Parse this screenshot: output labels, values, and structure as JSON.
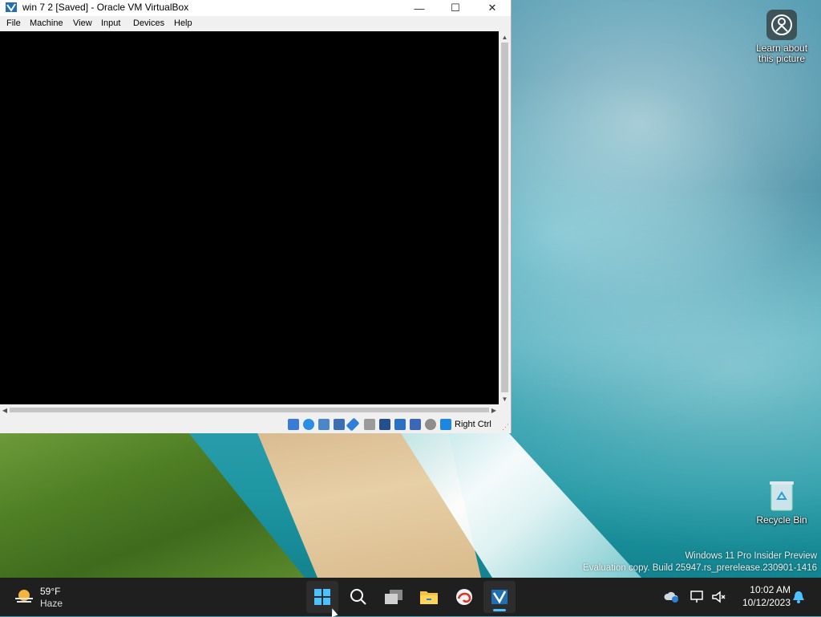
{
  "window": {
    "title": "win 7 2 [Saved] - Oracle VM VirtualBox",
    "minimize": "—",
    "maximize": "☐",
    "close": "✕"
  },
  "menu": {
    "items": [
      "File",
      "Machine",
      "View",
      "Input",
      "Devices",
      "Help"
    ]
  },
  "statusbar": {
    "host_key": "Right Ctrl",
    "icons": [
      "hard-disk-icon",
      "optical-drive-icon",
      "audio-icon",
      "network-icon",
      "usb-icon",
      "shared-folders-icon",
      "display-icon",
      "recording-icon",
      "vt-x-icon",
      "mouse-integration-icon",
      "keyboard-capture-icon"
    ]
  },
  "desktop": {
    "learn_label_line1": "Learn about",
    "learn_label_line2": "this picture",
    "recycle_label": "Recycle Bin",
    "watermark_line1": "Windows 11 Pro Insider Preview",
    "watermark_line2": "Evaluation copy. Build 25947.rs_prerelease.230901-1416"
  },
  "taskbar": {
    "weather_temp": "59°F",
    "weather_cond": "Haze",
    "apps": [
      "start-button",
      "search-button",
      "task-view-button",
      "file-explorer-button",
      "edge-dev-button",
      "virtualbox-button"
    ],
    "time": "10:02 AM",
    "date": "10/12/2023"
  },
  "colors": {
    "taskbar_bg": "#1f1f1f",
    "accent": "#4cc2ff",
    "vm_screen": "#000000"
  }
}
